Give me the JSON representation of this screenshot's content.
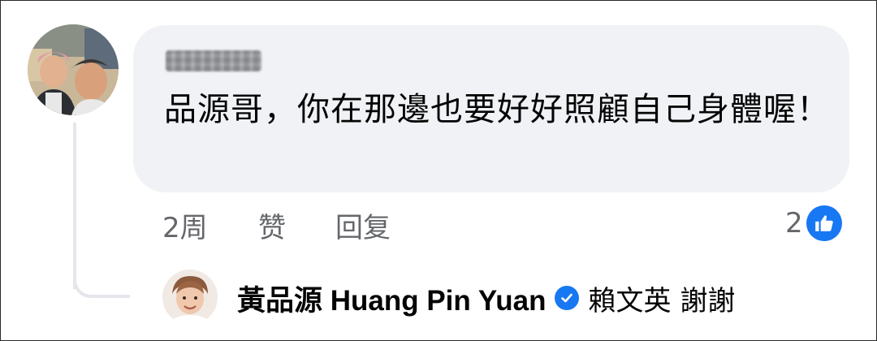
{
  "comment": {
    "text": "品源哥，你在那邊也要好好照顧自己身體喔！",
    "timestamp": "2周",
    "like_label": "赞",
    "reply_label": "回复",
    "reaction_count": "2",
    "reaction_icon": "thumbs-up-icon",
    "reaction_color": "#1877f2"
  },
  "reply": {
    "author": "黃品源 Huang Pin Yuan",
    "verified_icon": "verified-check-icon",
    "text": "賴文英 謝謝"
  },
  "colors": {
    "bubble": "#f0f2f5",
    "secondary_text": "#65676b",
    "primary_text": "#050505",
    "accent": "#1877f2"
  }
}
